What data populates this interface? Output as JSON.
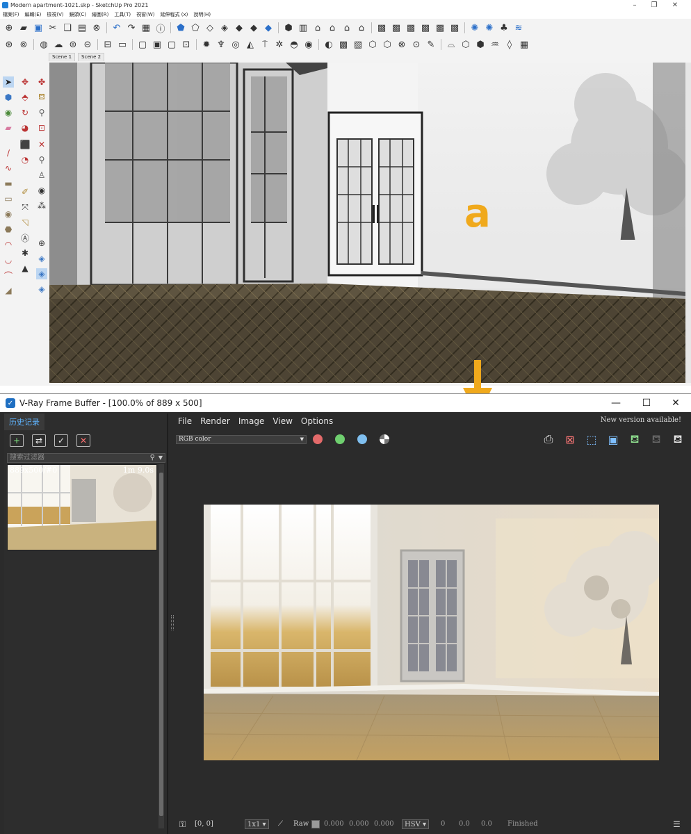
{
  "sketchup": {
    "window_title": "Modern apartment-1021.skp - SketchUp Pro 2021",
    "menu": [
      "檔案(F)",
      "編輯(E)",
      "檢視(V)",
      "鏡頭(C)",
      "繪圖(R)",
      "工具(T)",
      "視窗(W)",
      "延伸程式 (x)",
      "說明(H)"
    ],
    "scene_tabs": [
      "Scene 1",
      "Scene 2"
    ]
  },
  "annotation": {
    "letter": "a"
  },
  "vray": {
    "window_title": "V-Ray Frame Buffer - [100.0% of 889 x 500]",
    "history_tab": "历史记录",
    "search_placeholder": "搜索过滤器",
    "history_item": {
      "caption": "889x500/#0",
      "time": "1m 9.0s"
    },
    "menu": [
      "File",
      "Render",
      "Image",
      "View",
      "Options"
    ],
    "new_version": "New version available!",
    "channel": "RGB color",
    "channel_dots": [
      "#e36a6a",
      "#6fcf6f",
      "#7fbfef"
    ],
    "status": {
      "coords": "[0, 0]",
      "zoom": "1x1",
      "raw": "Raw",
      "rgb": [
        "0.000",
        "0.000",
        "0.000"
      ],
      "color_space": "HSV",
      "hsv": [
        "0",
        "0.0",
        "0.0"
      ],
      "state": "Finished"
    }
  },
  "colors": {
    "accent_orange": "#f0a91c",
    "vray_bg": "#2b2b2b",
    "history_tab_text": "#5fb4ff"
  }
}
